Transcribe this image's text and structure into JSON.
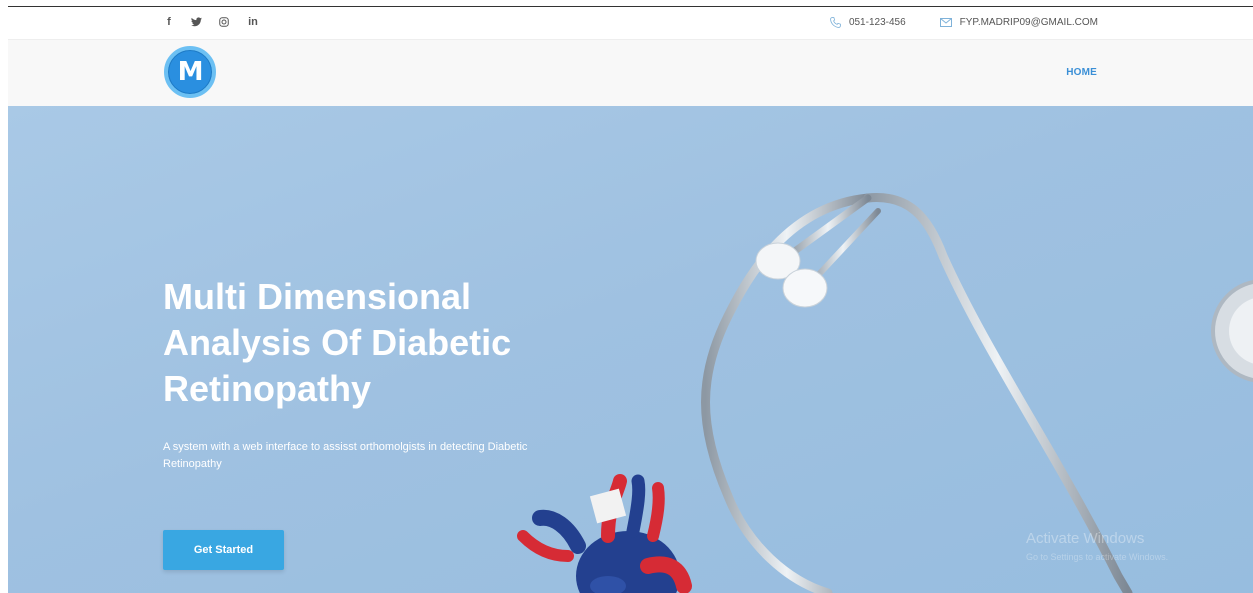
{
  "topbar": {
    "socials": [
      {
        "icon": "facebook-icon",
        "glyph": "f"
      },
      {
        "icon": "twitter-icon",
        "glyph": "y"
      },
      {
        "icon": "instagram-icon",
        "glyph": "◎"
      },
      {
        "icon": "linkedin-icon",
        "glyph": "in"
      }
    ],
    "phone": "051-123-456",
    "email": "FYP.MADRIP09@GMAIL.COM"
  },
  "navbar": {
    "logo_letter": "M",
    "home_label": "HOME"
  },
  "hero": {
    "title": "Multi Dimensional Analysis Of Diabetic Retinopathy",
    "subtitle": "A system with a web interface to assisst orthomolgists in detecting Diabetic Retinopathy",
    "button_label": "Get Started",
    "watermark_title": "Activate Windows",
    "watermark_sub": "Go to Settings to activate Windows."
  },
  "colors": {
    "accent": "#3b8fd6",
    "button": "#39a7e2",
    "hero_bg": "#a3c5e4",
    "logo": "#2a8fe0"
  }
}
